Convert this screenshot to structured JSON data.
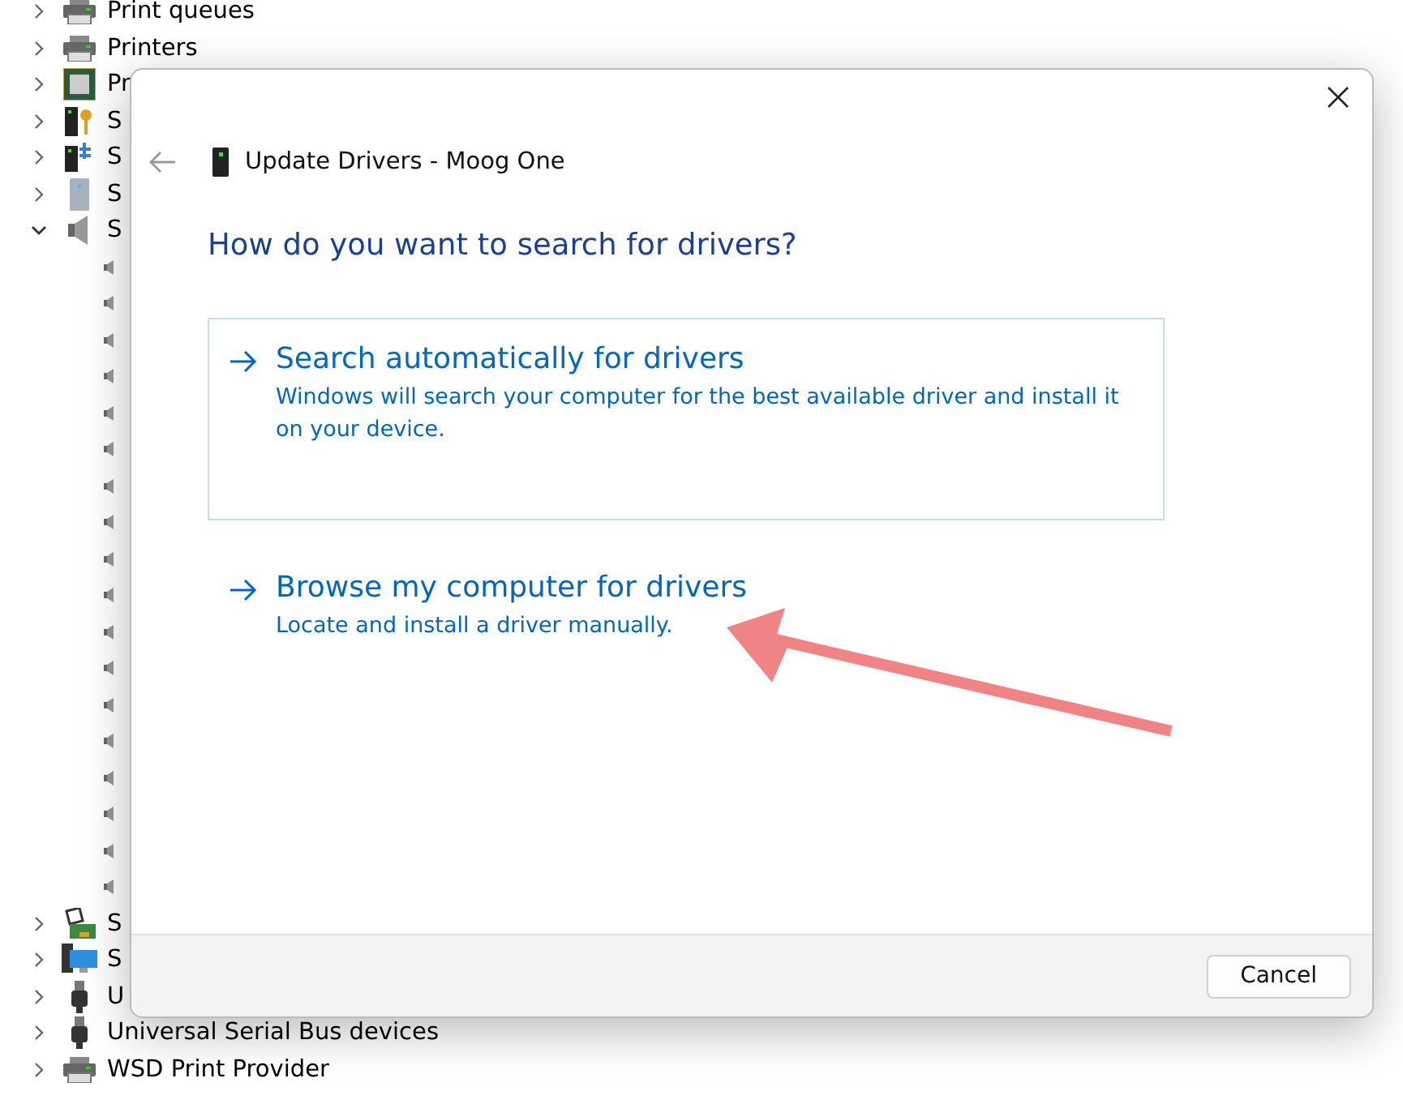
{
  "tree": {
    "items": [
      {
        "label": "Print queues",
        "kind": "printer",
        "expanded": false
      },
      {
        "label": "Printers",
        "kind": "printer",
        "expanded": false
      },
      {
        "label": "Pr",
        "kind": "chip",
        "expanded": false
      },
      {
        "label": "S",
        "kind": "key-server",
        "expanded": false
      },
      {
        "label": "S",
        "kind": "net-server",
        "expanded": false
      },
      {
        "label": "S",
        "kind": "tower",
        "expanded": false
      },
      {
        "label": "S",
        "kind": "speaker",
        "expanded": true,
        "children": [
          {
            "kind": "speaker"
          },
          {
            "kind": "speaker"
          },
          {
            "kind": "speaker"
          },
          {
            "kind": "speaker"
          },
          {
            "kind": "speaker"
          },
          {
            "kind": "speaker"
          },
          {
            "kind": "speaker"
          },
          {
            "kind": "speaker"
          },
          {
            "kind": "speaker"
          },
          {
            "kind": "speaker"
          },
          {
            "kind": "speaker"
          },
          {
            "kind": "speaker"
          },
          {
            "kind": "speaker"
          },
          {
            "kind": "speaker"
          },
          {
            "kind": "speaker"
          },
          {
            "kind": "speaker"
          },
          {
            "kind": "speaker"
          },
          {
            "kind": "speaker"
          }
        ]
      },
      {
        "label": "S",
        "kind": "storage",
        "expanded": false
      },
      {
        "label": "S",
        "kind": "monitor",
        "expanded": false
      },
      {
        "label": "U",
        "kind": "usb",
        "expanded": false
      },
      {
        "label": "Universal Serial Bus devices",
        "kind": "usb",
        "expanded": false
      },
      {
        "label": "WSD Print Provider",
        "kind": "printer",
        "expanded": false
      }
    ]
  },
  "dialog": {
    "title": "Update Drivers - Moog One",
    "heading": "How do you want to search for drivers?",
    "options": [
      {
        "title": "Search automatically for drivers",
        "description": "Windows will search your computer for the best available driver and install it on your device.",
        "focused": true
      },
      {
        "title": "Browse my computer for drivers",
        "description": "Locate and install a driver manually.",
        "focused": false
      }
    ],
    "buttons": [
      "Cancel"
    ]
  }
}
